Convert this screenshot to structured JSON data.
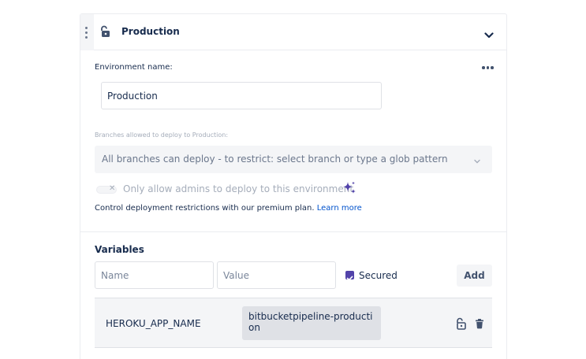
{
  "environment": {
    "title": "Production",
    "name_label": "Environment name:",
    "name_value": "Production",
    "branches_label": "Branches allowed to deploy to Production:",
    "branches_placeholder": "All branches can deploy - to restrict: select branch or type a glob pattern",
    "admin_toggle_label": "Only allow admins to deploy to this environment",
    "admin_toggle_on": false,
    "promo_text": "Control deployment restrictions with our premium plan.",
    "learn_more_label": "Learn more"
  },
  "variables": {
    "title": "Variables",
    "name_placeholder": "Name",
    "value_placeholder": "Value",
    "secured_label": "Secured",
    "secured_checked": true,
    "add_label": "Add",
    "rows": [
      {
        "name": "HEROKU_APP_NAME",
        "value": "bitbucketpipeline-production"
      }
    ]
  },
  "icons": {
    "drag": "drag-handle-icon",
    "header_lock": "unlock-icon",
    "collapse": "chevron-down-icon",
    "more": "more-icon",
    "select": "chevron-down-icon",
    "premium": "sparkle-icon",
    "row_lock": "unlock-icon",
    "row_delete": "trash-icon"
  },
  "colors": {
    "accent": "#5243aa",
    "link": "#0052cc",
    "text": "#172b4d",
    "muted": "#a5adba",
    "surface": "#f4f5f7"
  }
}
